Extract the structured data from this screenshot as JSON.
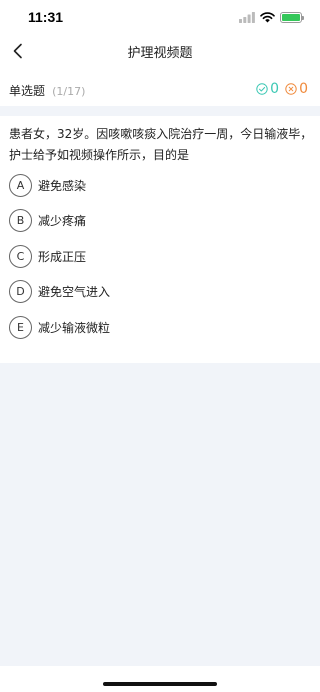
{
  "status_bar": {
    "time": "11:31"
  },
  "nav": {
    "title": "护理视频题"
  },
  "question_header": {
    "type": "单选题",
    "progress": "(1/17)"
  },
  "score": {
    "correct_count": "0",
    "wrong_count": "0",
    "correct_color": "#3cc8b4",
    "wrong_color": "#f08a3c"
  },
  "question": {
    "text": "患者女，32岁。因咳嗽咳痰入院治疗一周，今日输液毕，护士给予如视频操作所示，目的是"
  },
  "options": [
    {
      "letter": "A",
      "text": "避免感染"
    },
    {
      "letter": "B",
      "text": "减少疼痛"
    },
    {
      "letter": "C",
      "text": "形成正压"
    },
    {
      "letter": "D",
      "text": "避免空气进入"
    },
    {
      "letter": "E",
      "text": "减少输液微粒"
    }
  ],
  "icons": [
    "signal-icon",
    "wifi-icon",
    "battery-icon",
    "back-chevron-icon",
    "correct-check-icon",
    "wrong-cross-icon"
  ]
}
